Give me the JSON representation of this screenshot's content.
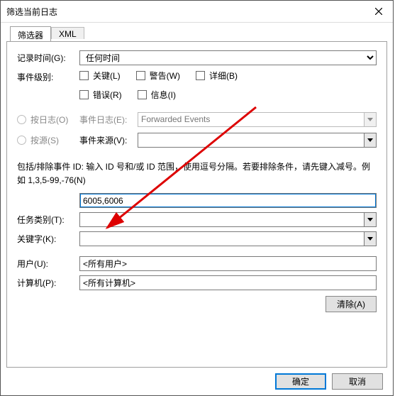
{
  "title": "筛选当前日志",
  "tabs": {
    "filter": "筛选器",
    "xml": "XML"
  },
  "labels": {
    "logged": "记录时间(G):",
    "level": "事件级别:",
    "bylog": "按日志(O)",
    "eventlog": "事件日志(E):",
    "bysource": "按源(S)",
    "source": "事件来源(V):",
    "help": "包括/排除事件 ID: 输入 ID 号和/或 ID 范围，使用逗号分隔。若要排除条件，请先键入减号。例如 1,3,5-99,-76(N)",
    "task": "任务类别(T):",
    "keywords": "关键字(K):",
    "user": "用户(U):",
    "computer": "计算机(P):",
    "clear": "清除(A)",
    "ok": "确定",
    "cancel": "取消"
  },
  "values": {
    "logged": "任何时间",
    "eventlog": "Forwarded Events",
    "source": "",
    "ids": "6005,6006",
    "task": "",
    "keywords": "",
    "user": "<所有用户>",
    "computer": "<所有计算机>"
  },
  "checks": {
    "critical": "关键(L)",
    "warning": "警告(W)",
    "verbose": "详细(B)",
    "error": "错误(R)",
    "info": "信息(I)"
  }
}
